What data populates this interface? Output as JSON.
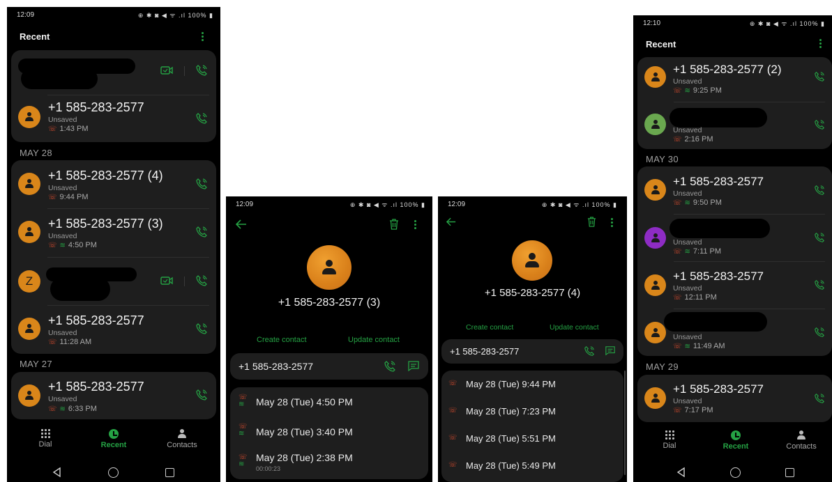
{
  "colors": {
    "accent": "#25a244",
    "missed": "#d04a2e",
    "avatar_orange": "#d9861a",
    "card_bg": "#1e1e1e",
    "background": "#000000"
  },
  "phone1": {
    "status_time": "12:09",
    "status_icons": "⊕ ✱ ◙ ◀ ᯤ .ıl 100% ▮",
    "title": "Recent",
    "card1": {
      "row2": {
        "number": "+1 585-283-2577",
        "sub": "Unsaved",
        "time": "1:43 PM"
      }
    },
    "date_header_1": "MAY 28",
    "card2": {
      "row1": {
        "number": "+1 585-283-2577 (4)",
        "sub": "Unsaved",
        "time": "9:44 PM"
      },
      "row2": {
        "number": "+1 585-283-2577 (3)",
        "sub": "Unsaved",
        "time": "4:50 PM"
      },
      "row3": {
        "letter": "Z"
      },
      "row4": {
        "number": "+1 585-283-2577",
        "sub": "Unsaved",
        "time": "11:28 AM"
      }
    },
    "date_header_2": "MAY 27",
    "card3": {
      "row1": {
        "number": "+1 585-283-2577",
        "sub": "Unsaved",
        "time": "6:33 PM"
      }
    },
    "nav": {
      "dial": "Dial",
      "recent": "Recent",
      "contacts": "Contacts"
    }
  },
  "phone2": {
    "status_time": "12:09",
    "status_icons": "⊕ ✱ ◙ ◀ ᯤ .ıl 100% ▮",
    "name": "+1 585-283-2577 (3)",
    "create_contact": "Create contact",
    "update_contact": "Update contact",
    "number": "+1 585-283-2577",
    "history": [
      {
        "text": "May 28 (Tue) 4:50 PM",
        "duration": ""
      },
      {
        "text": "May 28 (Tue) 3:40 PM",
        "duration": ""
      },
      {
        "text": "May 28 (Tue) 2:38 PM",
        "duration": "00:00:23"
      }
    ]
  },
  "phone3": {
    "status_time": "12:09",
    "status_icons": "⊕ ✱ ◙ ◀ ᯤ .ıl 100% ▮",
    "name": "+1 585-283-2577 (4)",
    "create_contact": "Create contact",
    "update_contact": "Update contact",
    "number": "+1 585-283-2577",
    "history": [
      {
        "text": "May 28 (Tue) 9:44 PM"
      },
      {
        "text": "May 28 (Tue) 7:23 PM"
      },
      {
        "text": "May 28 (Tue) 5:51 PM"
      },
      {
        "text": "May 28 (Tue) 5:49 PM"
      }
    ]
  },
  "phone4": {
    "status_time": "12:10",
    "status_icons": "⊕ ✱ ◙ ◀ ᯤ .ıl 100% ▮",
    "title": "Recent",
    "card1": {
      "row1": {
        "number": "+1 585-283-2577 (2)",
        "sub": "Unsaved",
        "time": "9:25 PM"
      },
      "row2": {
        "sub": "Unsaved",
        "time": "2:16 PM"
      }
    },
    "date_header_1": "MAY 30",
    "card2": {
      "row1": {
        "number": "+1 585-283-2577",
        "sub": "Unsaved",
        "time": "9:50 PM"
      },
      "row2": {
        "sub": "Unsaved",
        "time": "7:11 PM"
      },
      "row3": {
        "number": "+1 585-283-2577",
        "sub": "Unsaved",
        "time": "12:11 PM"
      },
      "row4": {
        "sub": "Unsaved",
        "time": "11:49 AM"
      }
    },
    "date_header_2": "MAY 29",
    "card3": {
      "row1": {
        "number": "+1 585-283-2577",
        "sub": "Unsaved",
        "time": "7:17 PM"
      }
    },
    "nav": {
      "dial": "Dial",
      "recent": "Recent",
      "contacts": "Contacts"
    }
  }
}
